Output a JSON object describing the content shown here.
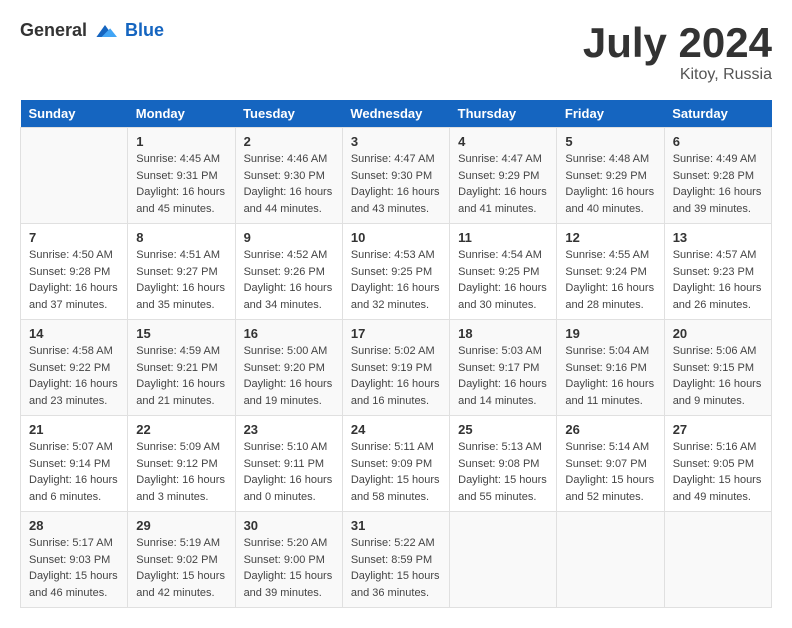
{
  "header": {
    "logo_general": "General",
    "logo_blue": "Blue",
    "month_year": "July 2024",
    "location": "Kitoy, Russia"
  },
  "days_of_week": [
    "Sunday",
    "Monday",
    "Tuesday",
    "Wednesday",
    "Thursday",
    "Friday",
    "Saturday"
  ],
  "weeks": [
    [
      {
        "day": "",
        "info": ""
      },
      {
        "day": "1",
        "info": "Sunrise: 4:45 AM\nSunset: 9:31 PM\nDaylight: 16 hours\nand 45 minutes."
      },
      {
        "day": "2",
        "info": "Sunrise: 4:46 AM\nSunset: 9:30 PM\nDaylight: 16 hours\nand 44 minutes."
      },
      {
        "day": "3",
        "info": "Sunrise: 4:47 AM\nSunset: 9:30 PM\nDaylight: 16 hours\nand 43 minutes."
      },
      {
        "day": "4",
        "info": "Sunrise: 4:47 AM\nSunset: 9:29 PM\nDaylight: 16 hours\nand 41 minutes."
      },
      {
        "day": "5",
        "info": "Sunrise: 4:48 AM\nSunset: 9:29 PM\nDaylight: 16 hours\nand 40 minutes."
      },
      {
        "day": "6",
        "info": "Sunrise: 4:49 AM\nSunset: 9:28 PM\nDaylight: 16 hours\nand 39 minutes."
      }
    ],
    [
      {
        "day": "7",
        "info": "Sunrise: 4:50 AM\nSunset: 9:28 PM\nDaylight: 16 hours\nand 37 minutes."
      },
      {
        "day": "8",
        "info": "Sunrise: 4:51 AM\nSunset: 9:27 PM\nDaylight: 16 hours\nand 35 minutes."
      },
      {
        "day": "9",
        "info": "Sunrise: 4:52 AM\nSunset: 9:26 PM\nDaylight: 16 hours\nand 34 minutes."
      },
      {
        "day": "10",
        "info": "Sunrise: 4:53 AM\nSunset: 9:25 PM\nDaylight: 16 hours\nand 32 minutes."
      },
      {
        "day": "11",
        "info": "Sunrise: 4:54 AM\nSunset: 9:25 PM\nDaylight: 16 hours\nand 30 minutes."
      },
      {
        "day": "12",
        "info": "Sunrise: 4:55 AM\nSunset: 9:24 PM\nDaylight: 16 hours\nand 28 minutes."
      },
      {
        "day": "13",
        "info": "Sunrise: 4:57 AM\nSunset: 9:23 PM\nDaylight: 16 hours\nand 26 minutes."
      }
    ],
    [
      {
        "day": "14",
        "info": "Sunrise: 4:58 AM\nSunset: 9:22 PM\nDaylight: 16 hours\nand 23 minutes."
      },
      {
        "day": "15",
        "info": "Sunrise: 4:59 AM\nSunset: 9:21 PM\nDaylight: 16 hours\nand 21 minutes."
      },
      {
        "day": "16",
        "info": "Sunrise: 5:00 AM\nSunset: 9:20 PM\nDaylight: 16 hours\nand 19 minutes."
      },
      {
        "day": "17",
        "info": "Sunrise: 5:02 AM\nSunset: 9:19 PM\nDaylight: 16 hours\nand 16 minutes."
      },
      {
        "day": "18",
        "info": "Sunrise: 5:03 AM\nSunset: 9:17 PM\nDaylight: 16 hours\nand 14 minutes."
      },
      {
        "day": "19",
        "info": "Sunrise: 5:04 AM\nSunset: 9:16 PM\nDaylight: 16 hours\nand 11 minutes."
      },
      {
        "day": "20",
        "info": "Sunrise: 5:06 AM\nSunset: 9:15 PM\nDaylight: 16 hours\nand 9 minutes."
      }
    ],
    [
      {
        "day": "21",
        "info": "Sunrise: 5:07 AM\nSunset: 9:14 PM\nDaylight: 16 hours\nand 6 minutes."
      },
      {
        "day": "22",
        "info": "Sunrise: 5:09 AM\nSunset: 9:12 PM\nDaylight: 16 hours\nand 3 minutes."
      },
      {
        "day": "23",
        "info": "Sunrise: 5:10 AM\nSunset: 9:11 PM\nDaylight: 16 hours\nand 0 minutes."
      },
      {
        "day": "24",
        "info": "Sunrise: 5:11 AM\nSunset: 9:09 PM\nDaylight: 15 hours\nand 58 minutes."
      },
      {
        "day": "25",
        "info": "Sunrise: 5:13 AM\nSunset: 9:08 PM\nDaylight: 15 hours\nand 55 minutes."
      },
      {
        "day": "26",
        "info": "Sunrise: 5:14 AM\nSunset: 9:07 PM\nDaylight: 15 hours\nand 52 minutes."
      },
      {
        "day": "27",
        "info": "Sunrise: 5:16 AM\nSunset: 9:05 PM\nDaylight: 15 hours\nand 49 minutes."
      }
    ],
    [
      {
        "day": "28",
        "info": "Sunrise: 5:17 AM\nSunset: 9:03 PM\nDaylight: 15 hours\nand 46 minutes."
      },
      {
        "day": "29",
        "info": "Sunrise: 5:19 AM\nSunset: 9:02 PM\nDaylight: 15 hours\nand 42 minutes."
      },
      {
        "day": "30",
        "info": "Sunrise: 5:20 AM\nSunset: 9:00 PM\nDaylight: 15 hours\nand 39 minutes."
      },
      {
        "day": "31",
        "info": "Sunrise: 5:22 AM\nSunset: 8:59 PM\nDaylight: 15 hours\nand 36 minutes."
      },
      {
        "day": "",
        "info": ""
      },
      {
        "day": "",
        "info": ""
      },
      {
        "day": "",
        "info": ""
      }
    ]
  ]
}
